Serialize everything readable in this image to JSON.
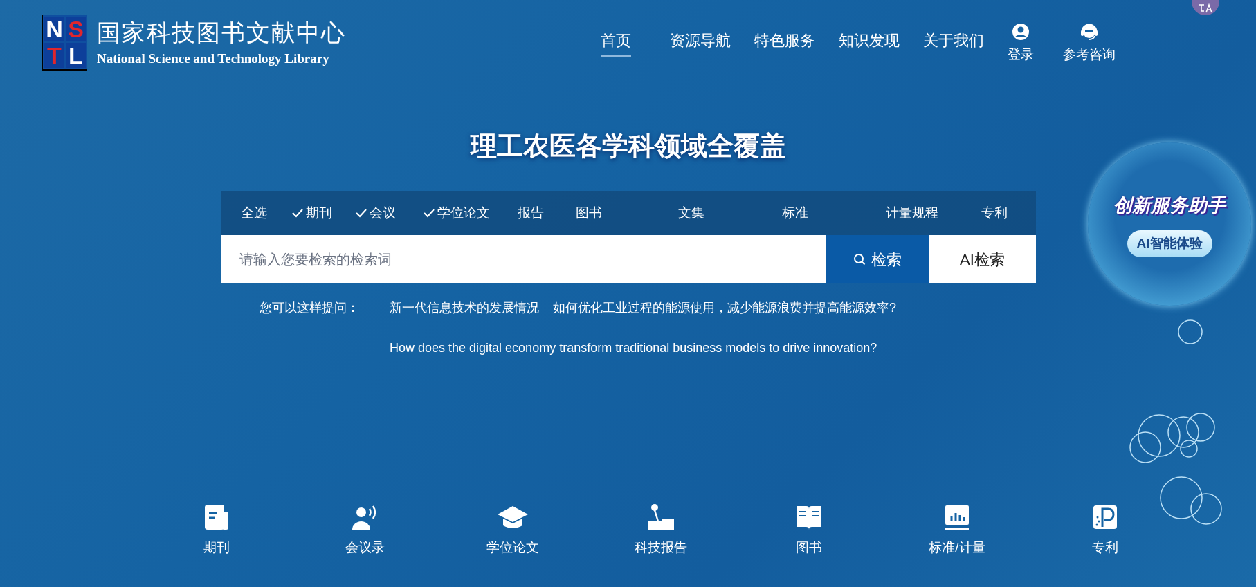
{
  "logo": {
    "letters": [
      "N",
      "S",
      "T",
      "L"
    ],
    "title": "国家科技图书文献中心",
    "subtitle": "National Science and Technology Library"
  },
  "nav": [
    {
      "label": "首页",
      "selected": true
    },
    {
      "label": "资源导航",
      "selected": false
    },
    {
      "label": "特色服务",
      "selected": false
    },
    {
      "label": "知识发现",
      "selected": false
    },
    {
      "label": "关于我们",
      "selected": false
    }
  ],
  "user_links": [
    {
      "kind": "user",
      "label": "登录"
    },
    {
      "kind": "support",
      "label": "参考咨询"
    }
  ],
  "headline": "理工农医各学科领域全覆盖",
  "filters": [
    {
      "label": "全选",
      "checked": false
    },
    {
      "label": "期刊",
      "checked": true
    },
    {
      "label": "会议",
      "checked": true
    },
    {
      "label": "学位论文",
      "checked": true
    },
    {
      "label": "报告",
      "checked": false
    },
    {
      "label": "图书",
      "checked": false
    },
    {
      "label": "文集",
      "checked": false
    },
    {
      "label": "标准",
      "checked": false
    },
    {
      "label": "计量规程",
      "checked": false
    },
    {
      "label": "专利",
      "checked": false
    }
  ],
  "search": {
    "placeholder": "请输入您要检索的检索词",
    "search_button": "检索",
    "ai_button": "AI检索"
  },
  "suggestions": {
    "label": "您可以这样提问：",
    "questions": [
      "新一代信息技术的发展情况",
      "如何优化工业过程的能源使用，减少能源浪费并提高能源效率?",
      "How does the digital economy transform traditional business models to drive innovation?"
    ]
  },
  "assistant": {
    "title": "创新服务助手",
    "button": "AI智能体验"
  },
  "categories": [
    {
      "kind": "journal",
      "label": "期刊"
    },
    {
      "kind": "conference",
      "label": "会议录"
    },
    {
      "kind": "thesis",
      "label": "学位论文"
    },
    {
      "kind": "report",
      "label": "科技报告"
    },
    {
      "kind": "book",
      "label": "图书"
    },
    {
      "kind": "standard",
      "label": "标准/计量"
    },
    {
      "kind": "patent",
      "label": "专利"
    }
  ]
}
